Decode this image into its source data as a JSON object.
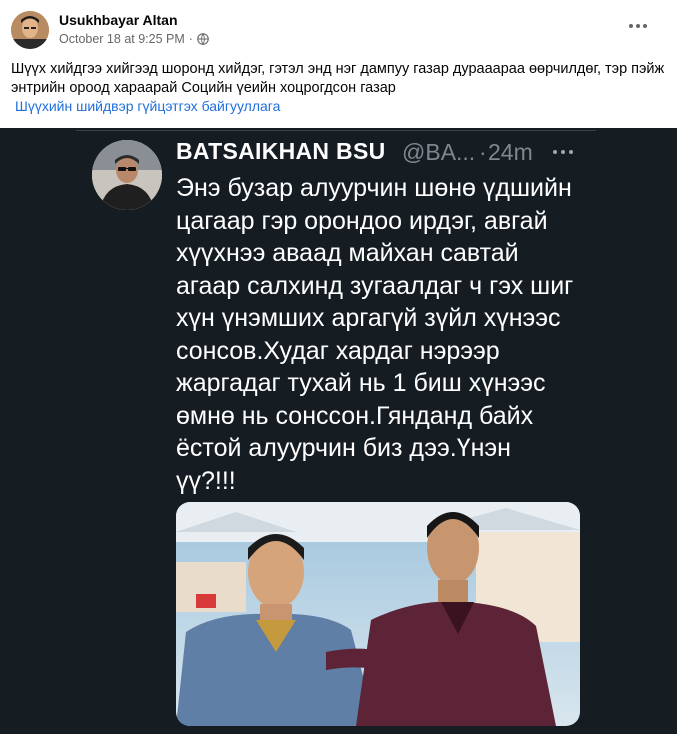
{
  "post": {
    "author": "Usukhbayar Altan",
    "timestamp": "October 18 at 9:25 PM",
    "separator": "·",
    "audience_icon": "globe-icon",
    "more_icon": "more-horizontal-icon",
    "text": "Шүүх хийдгээ хийгээд шоронд хийдэг, гэтэл энд нэг дампуу газар дурааараа өөрчилдөг, тэр пэйж энтрийн ороод хараарай Социйн үеийн хоцрогдсон газар",
    "link_text": "Шүүхийн шийдвэр гүйцэтгэх байгууллага"
  },
  "tweet": {
    "name": "BATSAIKHAN BSU",
    "handle": "@BA...",
    "dot": "·",
    "time": "24m",
    "more_icon": "more-horizontal-icon",
    "lines": [
      "Энэ бузар алуурчин шөнө үдшийн",
      "цагаар гэр орондоо ирдэг, авгай",
      "хүүхнээ аваад майхан савтай",
      "агаар салхинд зугаалдаг ч гэх шиг",
      "хүн үнэмших аргагүй зүйл хүнээс",
      "сонсов.Худаг хардаг нэрээр",
      "жаргадаг тухай нь 1 биш хүнээс",
      "өмнө нь сонссон.Гянданд байх",
      "ёстой алуурчин биз дээ.Үнэн",
      "үү?!!!"
    ]
  },
  "colors": {
    "link": "#216fdb",
    "screenshot_bg": "#151d23",
    "muted": "#65676b"
  }
}
